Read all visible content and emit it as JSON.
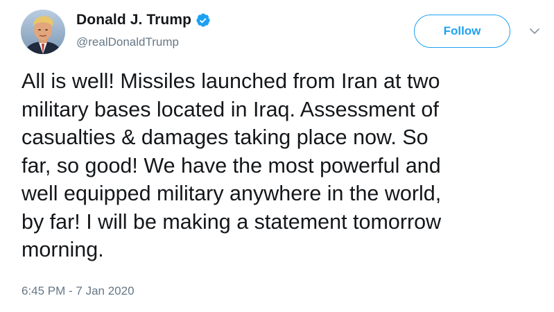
{
  "author": {
    "display_name": "Donald J. Trump",
    "handle": "@realDonaldTrump",
    "verified": true,
    "avatar_icon": "profile-photo"
  },
  "actions": {
    "follow_label": "Follow",
    "menu_icon": "chevron-down-icon"
  },
  "tweet": {
    "lines": [
      "All is well! Missiles launched from Iran at two",
      "military bases located in Iraq. Assessment of",
      "casualties & damages taking place now. So",
      "far, so good! We have the most powerful and",
      "well equipped military anywhere in the world,",
      "by far! I will be making a statement tomorrow",
      "morning."
    ],
    "timestamp": "6:45 PM - 7 Jan 2020"
  },
  "colors": {
    "accent": "#1da1f2",
    "text": "#14171a",
    "secondary_text": "#657786",
    "background": "#ffffff"
  }
}
